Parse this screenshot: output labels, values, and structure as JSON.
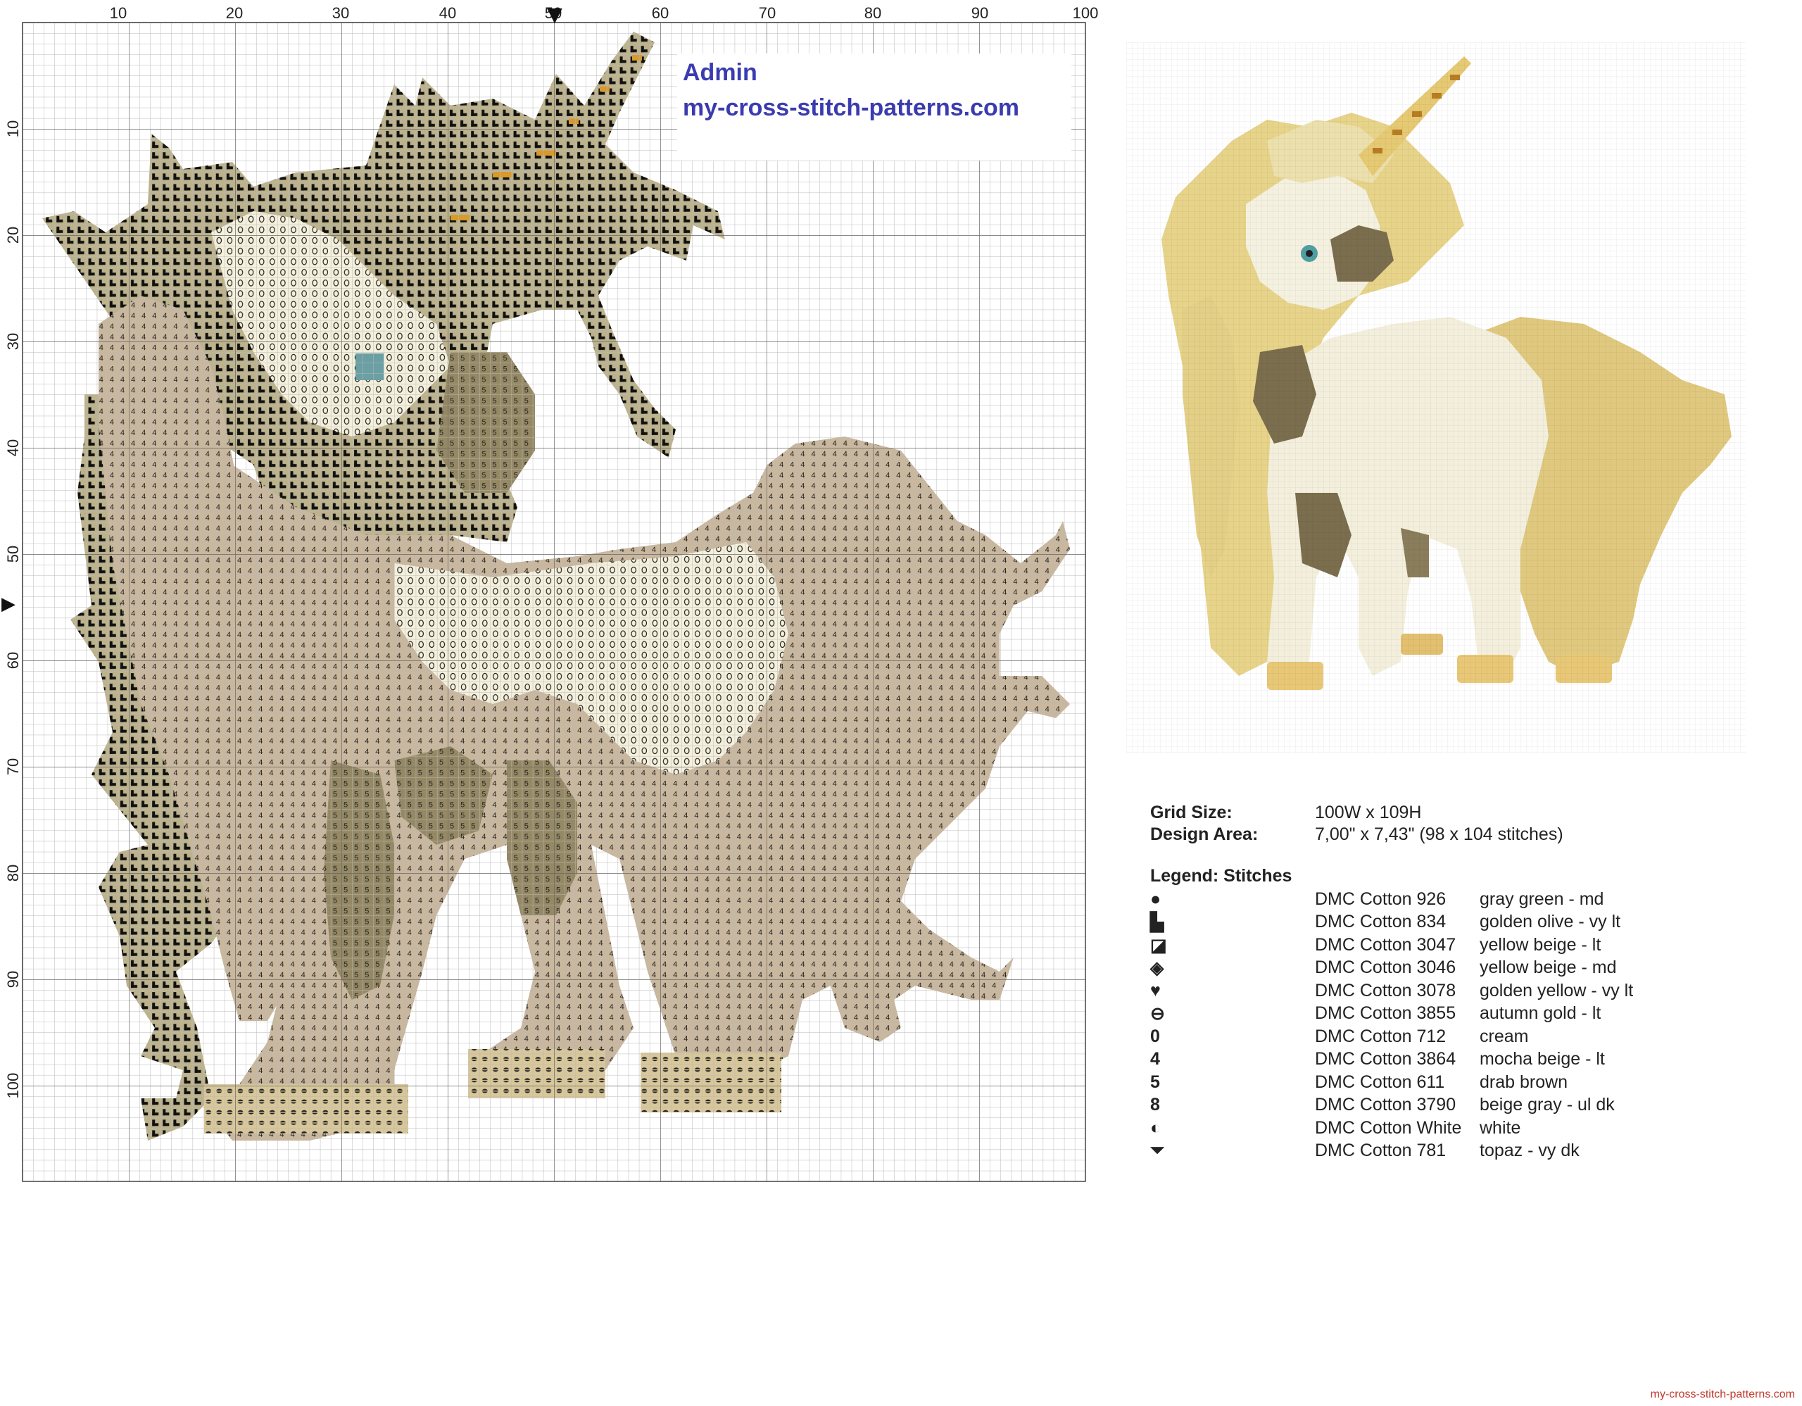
{
  "chart": {
    "x_ticks": [
      "10",
      "20",
      "30",
      "40",
      "50",
      "60",
      "70",
      "80",
      "90",
      "100"
    ],
    "y_ticks": [
      "10",
      "20",
      "30",
      "40",
      "50",
      "60",
      "70",
      "80",
      "90",
      "100"
    ],
    "center_marker": "▼",
    "side_marker": "▶"
  },
  "watermark": {
    "admin": "Admin",
    "site": "my-cross-stitch-patterns.com"
  },
  "info": {
    "grid_size_label": "Grid Size:",
    "grid_size_value": "100W x 109H",
    "design_area_label": "Design Area:",
    "design_area_value": "7,00\" x 7,43\"   (98 x 104 stitches)"
  },
  "legend": {
    "title": "Legend: Stitches",
    "items": [
      {
        "symbol": "●",
        "code": "DMC Cotton 926",
        "name": "gray green - md"
      },
      {
        "symbol": "▙",
        "code": "DMC Cotton 834",
        "name": "golden olive - vy lt"
      },
      {
        "symbol": "◪",
        "code": "DMC Cotton 3047",
        "name": "yellow beige - lt"
      },
      {
        "symbol": "◈",
        "code": "DMC Cotton 3046",
        "name": "yellow beige - md"
      },
      {
        "symbol": "♥",
        "code": "DMC Cotton 3078",
        "name": "golden yellow - vy lt"
      },
      {
        "symbol": "⊖",
        "code": "DMC Cotton 3855",
        "name": "autumn gold - lt"
      },
      {
        "symbol": "0",
        "code": "DMC Cotton 712",
        "name": "cream"
      },
      {
        "symbol": "4",
        "code": "DMC Cotton 3864",
        "name": "mocha beige - lt"
      },
      {
        "symbol": "5",
        "code": "DMC Cotton 611",
        "name": "drab brown"
      },
      {
        "symbol": "8",
        "code": "DMC Cotton 3790",
        "name": "beige gray - ul dk"
      },
      {
        "symbol": "◐",
        "code": "DMC Cotton White",
        "name": "white"
      },
      {
        "symbol": "⏷",
        "code": "DMC Cotton 781",
        "name": "topaz - vy dk"
      }
    ]
  },
  "footer": "my-cross-stitch-patterns.com",
  "colors": {
    "fill_dark": "#b8ad85",
    "fill_mocha": "#c8b49c",
    "fill_cream": "#f2eed8",
    "fill_brown": "#8a7f62",
    "preview_gold": "#e3cf86",
    "preview_cream": "#f4f0dc",
    "preview_brown": "#7d7050",
    "horn": "#c48a2c",
    "eye": "#4f9fa3"
  }
}
